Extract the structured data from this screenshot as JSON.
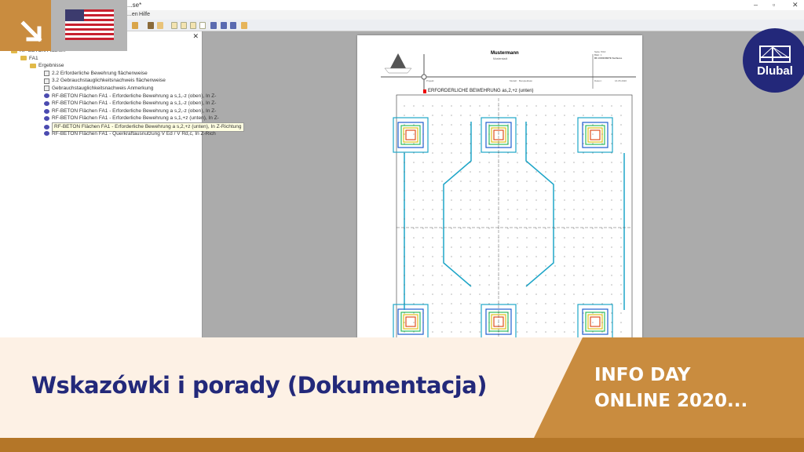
{
  "window": {
    "title": "...se*",
    "minimize": "–",
    "maximize": "▫",
    "close": "✕"
  },
  "menu": {
    "items": [
      "...en",
      "Hilfe"
    ]
  },
  "panel": {
    "close": "✕"
  },
  "tree": [
    {
      "label": "RF-BETON Flächen",
      "type": "folder",
      "level": 0
    },
    {
      "label": "FA1",
      "type": "folder",
      "level": 1
    },
    {
      "label": "Ergebnisse",
      "type": "folder",
      "level": 2
    },
    {
      "label": "2.2 Erforderliche Bewehrung flächenweise",
      "type": "table",
      "level": 3
    },
    {
      "label": "3.2 Gebrauchstauglichkeitsnachweis flächenweise",
      "type": "table",
      "level": 3
    },
    {
      "label": "Gebrauchstauglichkeitsnachweis Anmerkung",
      "type": "table",
      "level": 3
    },
    {
      "label": "RF-BETON Flächen FA1 - Erforderliche Bewehrung a s,1,-z (oben), In Z-",
      "type": "result",
      "level": 3
    },
    {
      "label": "RF-BETON Flächen FA1 - Erforderliche Bewehrung a s,1,-z (oben), In Z-",
      "type": "result",
      "level": 3
    },
    {
      "label": "RF-BETON Flächen FA1 - Erforderliche Bewehrung a s,2,-z (oben), In Z-",
      "type": "result",
      "level": 3
    },
    {
      "label": "RF-BETON Flächen FA1 - Erforderliche Bewehrung a s,1,+z (unten), In Z-",
      "type": "result",
      "level": 3
    },
    {
      "label": "RF-BETON Flächen FA1 - Erforderliche Bewehrung a s,2,+z (unten), In Z-Richtung",
      "type": "result",
      "level": 3,
      "tooltip": true
    },
    {
      "label": "RF-BETON Flächen FA1 - Querkraftausnutzung V Ed / V Rd,c, In Z-Rich",
      "type": "result",
      "level": 3
    }
  ],
  "report": {
    "company": "Mustermann",
    "city": "Musterstadt",
    "sub": "---------",
    "seite_label": "Seite:",
    "seite": "5/10",
    "blatt_label": "Blatt:",
    "blatt": "1",
    "module": "RF-CONCRETE Surfaces",
    "projekt_label": "Projekt:",
    "modell_label": "Modell:",
    "modell": "Beispieldatei",
    "datum_label": "Datum:",
    "datum": "16.05.2020",
    "heading": "ERFORDERLICHE BEWEHRUNG as,2,+z (unten)"
  },
  "banner": {
    "title": "Wskazówki i porady (Dokumentacja)",
    "event_line1": "INFO DAY",
    "event_line2": "ONLINE 2020..."
  },
  "logo": {
    "text": "Dlubal"
  },
  "colors": {
    "accent": "#c98c3f",
    "navy": "#23287a",
    "cream": "#fdf1e5"
  }
}
